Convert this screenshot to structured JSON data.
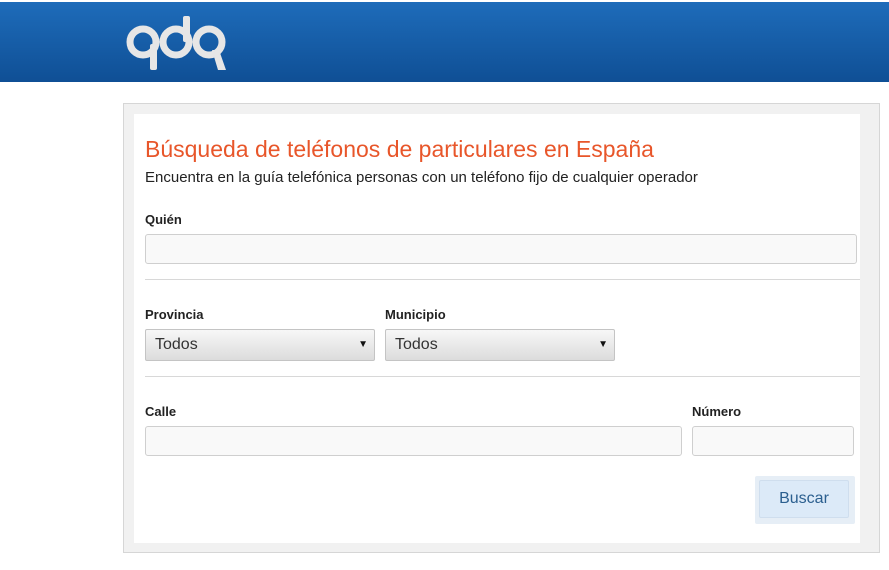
{
  "header": {
    "logo_text": "qdq",
    "colors": {
      "bar_top": "#1e6cba",
      "bar_bottom": "#0f4f95",
      "logo": "#e6e6e6"
    }
  },
  "form": {
    "title": "Búsqueda de teléfonos de particulares en España",
    "subtitle": "Encuentra en la guía telefónica personas con un teléfono fijo de cualquier operador",
    "quien": {
      "label": "Quién",
      "value": "",
      "placeholder": ""
    },
    "provincia": {
      "label": "Provincia",
      "selected": "Todos",
      "arrow_icon": "triangle-down-icon"
    },
    "municipio": {
      "label": "Municipio",
      "selected": "Todos",
      "arrow_icon": "triangle-down-icon"
    },
    "calle": {
      "label": "Calle",
      "value": "",
      "placeholder": ""
    },
    "numero": {
      "label": "Número",
      "value": "",
      "placeholder": ""
    },
    "submit_label": "Buscar",
    "colors": {
      "title": "#e8562a",
      "button_text": "#2b5f8f",
      "button_bg": "#dceaf8"
    }
  }
}
